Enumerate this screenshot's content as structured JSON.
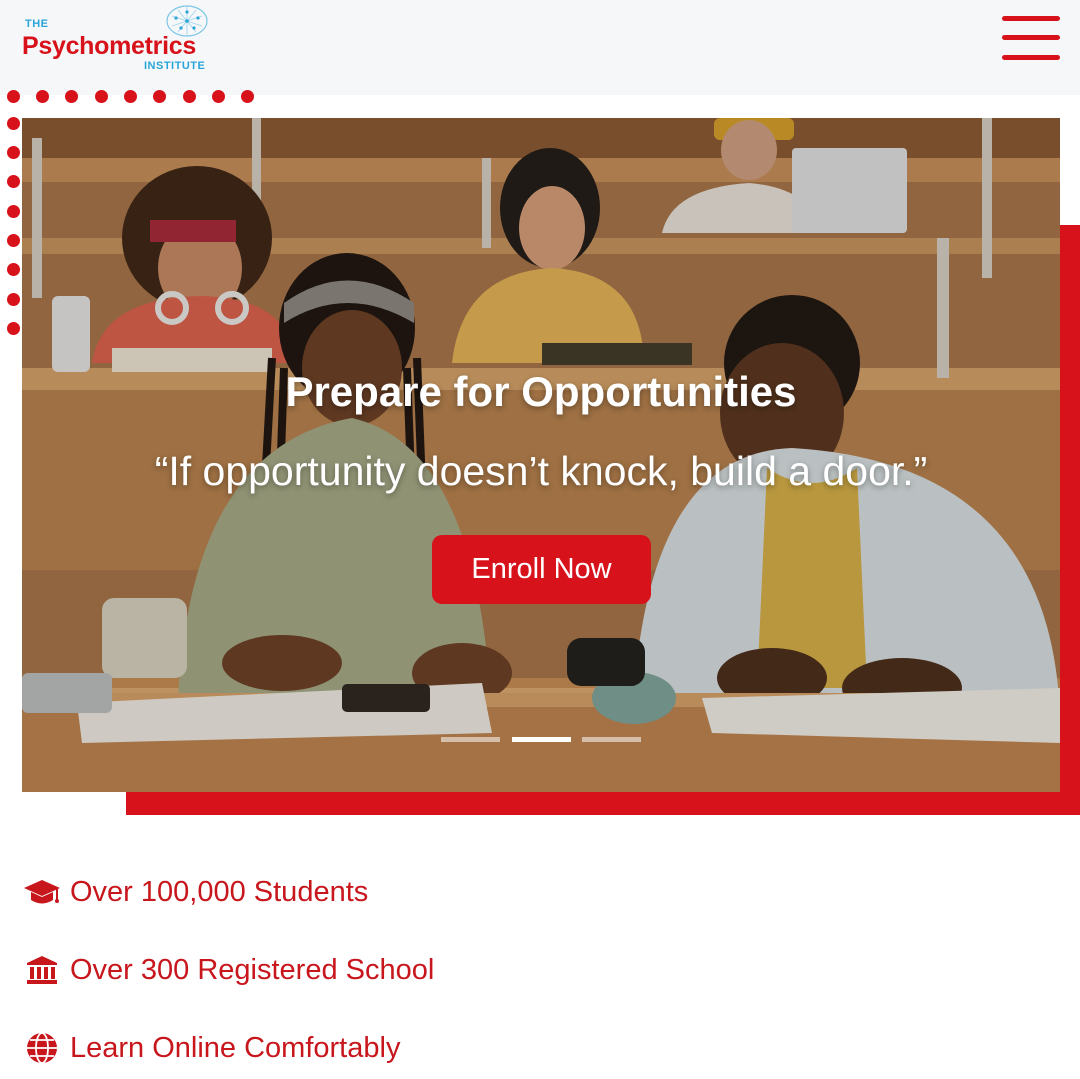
{
  "header": {
    "logo": {
      "the": "THE",
      "name": "Psychometrics",
      "institute": "INSTITUTE"
    },
    "menu_icon": "hamburger-menu-icon"
  },
  "hero": {
    "title": "Prepare for Opportunities",
    "quote": "“If opportunity doesn’t knock, build a door.”",
    "cta_label": "Enroll Now",
    "slides_total": 3,
    "active_slide": 2
  },
  "features": [
    {
      "icon": "graduation-cap-icon",
      "label": "Over 100,000 Students"
    },
    {
      "icon": "institution-icon",
      "label": "Over 300 Registered School"
    },
    {
      "icon": "globe-icon",
      "label": "Learn Online Comfortably"
    }
  ],
  "colors": {
    "brand_red": "#d8121b",
    "brand_blue": "#2aa5d8",
    "header_bg": "#f6f7f9"
  }
}
